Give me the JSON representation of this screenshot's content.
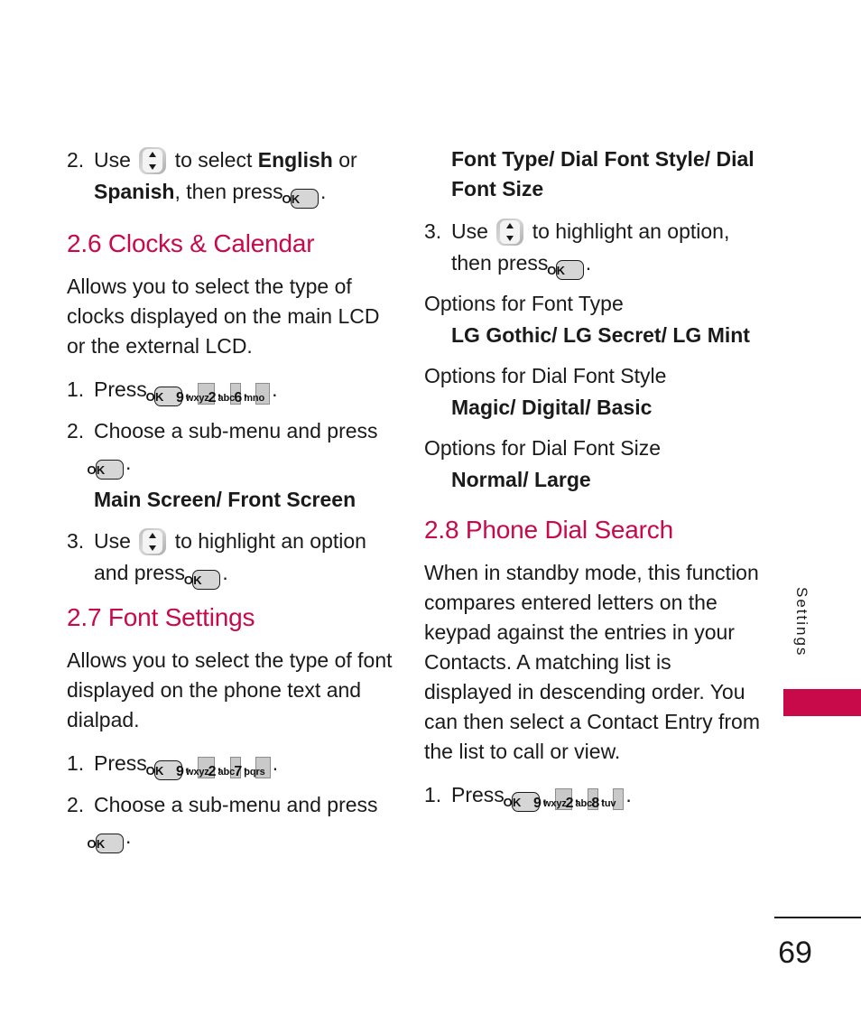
{
  "page": {
    "number": "69",
    "side_tab_label": "Settings",
    "accent_color": "#c8094a",
    "text_color": "#1a1a1a"
  },
  "keys": {
    "ok": "OK",
    "nav": "up-down-navigation-key",
    "k9": {
      "digit": "9",
      "letters": "wxyz"
    },
    "k2": {
      "digit": "2",
      "letters": "abc"
    },
    "k6": {
      "digit": "6",
      "letters": "mno"
    },
    "k7": {
      "digit": "7",
      "letters": "pqrs"
    },
    "k8": {
      "digit": "8",
      "letters": "tuv"
    }
  },
  "left_column": {
    "step2_lang": {
      "num": "2.",
      "t1": "Use",
      "t2": "to select",
      "b1": "English",
      "t3": "or",
      "b2": "Spanish",
      "t4": ", then press",
      "t5": "."
    },
    "section_26": {
      "heading": "2.6 Clocks & Calendar",
      "body": "Allows you to select the type of clocks displayed on the main LCD or the external LCD.",
      "step1": {
        "num": "1.",
        "label": "Press",
        "sep": ",",
        "end": "."
      },
      "step2": {
        "num": "2.",
        "label": "Choose a sub-menu and press",
        "end": "."
      },
      "submenu_options": "Main Screen/ Front Screen",
      "step3": {
        "num": "3.",
        "t1": "Use",
        "t2": "to highlight an option and press",
        "t3": "."
      }
    },
    "section_27": {
      "heading": "2.7 Font Settings",
      "body": "Allows you to select the type of font displayed on the phone text and dialpad.",
      "step1": {
        "num": "1.",
        "label": "Press",
        "sep": ",",
        "end": "."
      },
      "step2": {
        "num": "2.",
        "label": "Choose a sub-menu and press",
        "end": "."
      }
    }
  },
  "right_column": {
    "section_27_cont": {
      "submenu_options": "Font Type/ Dial Font Style/ Dial Font Size",
      "step3": {
        "num": "3.",
        "t1": "Use",
        "t2": "to highlight an option, then press",
        "t3": "."
      },
      "opt_font_type_label": "Options for Font Type",
      "opt_font_type_value": "LG Gothic/ LG Secret/ LG Mint",
      "opt_dial_style_label": "Options for Dial Font Style",
      "opt_dial_style_value": "Magic/ Digital/ Basic",
      "opt_dial_size_label": "Options for Dial Font Size",
      "opt_dial_size_value": "Normal/ Large"
    },
    "section_28": {
      "heading": "2.8 Phone Dial Search",
      "body": "When in standby mode, this function compares entered letters on the keypad against the entries in your Contacts. A matching list is displayed in descending order. You can then select a Contact Entry from the list to call or view.",
      "step1": {
        "num": "1.",
        "label": "Press",
        "sep": ",",
        "end": "."
      }
    }
  }
}
